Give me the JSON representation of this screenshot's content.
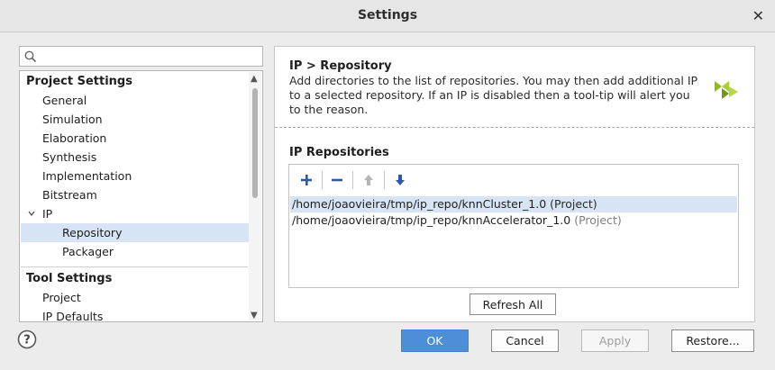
{
  "window": {
    "title": "Settings",
    "close_glyph": "✕"
  },
  "search": {
    "placeholder": "",
    "value": ""
  },
  "tree": {
    "sections": [
      {
        "label": "Project Settings",
        "items": [
          "General",
          "Simulation",
          "Elaboration",
          "Synthesis",
          "Implementation",
          "Bitstream",
          "IP"
        ],
        "children": [
          "Repository",
          "Packager"
        ]
      },
      {
        "label": "Tool Settings",
        "items": [
          "Project",
          "IP Defaults"
        ]
      }
    ],
    "selected": "Repository"
  },
  "panel": {
    "heading": "IP > Repository",
    "description_lines": [
      "Add directories to the list of repositories. You may then add additional IP",
      "to a selected repository. If an IP is disabled then a tool-tip will alert you",
      "to the reason."
    ],
    "repositories_label": "IP Repositories",
    "repositories": [
      {
        "path": "/home/joaovieira/tmp/ip_repo/knnCluster_1.0",
        "tag": "(Project)",
        "selected": true
      },
      {
        "path": "/home/joaovieira/tmp/ip_repo/knnAccelerator_1.0",
        "tag": "(Project)",
        "selected": false
      }
    ],
    "refresh_label": "Refresh All"
  },
  "buttons": {
    "ok": "OK",
    "cancel": "Cancel",
    "apply": "Apply",
    "restore": "Restore..."
  },
  "colors": {
    "accent": "#4d8ed9",
    "selection": "#d6e4f5",
    "toolbar_icon": "#2e5aa0",
    "logo_green": "#8fbc1a"
  },
  "icons": [
    "search-icon",
    "add-icon",
    "remove-icon",
    "move-up-icon",
    "move-down-icon",
    "help-icon",
    "close-icon",
    "vendor-logo-icon"
  ]
}
